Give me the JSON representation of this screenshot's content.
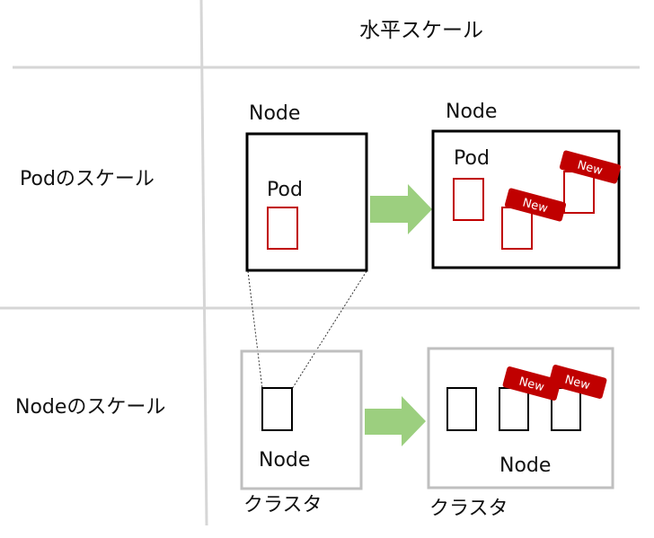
{
  "header": {
    "title": "水平スケール"
  },
  "rows": {
    "pod_scale": "Podのスケール",
    "node_scale": "Nodeのスケール"
  },
  "pod_section": {
    "before": {
      "node_label": "Node",
      "pod_label": "Pod"
    },
    "after": {
      "node_label": "Node",
      "pod_label": "Pod",
      "new_badges": [
        "New",
        "New"
      ]
    }
  },
  "node_section": {
    "before": {
      "node_label": "Node",
      "cluster_label": "クラスタ"
    },
    "after": {
      "node_label": "Node",
      "cluster_label": "クラスタ",
      "new_badges": [
        "New",
        "New"
      ]
    }
  },
  "colors": {
    "divider": "#d6d6d6",
    "node_border": "#000000",
    "cluster_border": "#bfbfbf",
    "pod_border": "#c00000",
    "badge_fill": "#c00000",
    "arrow_fill": "#9ccf7f"
  }
}
